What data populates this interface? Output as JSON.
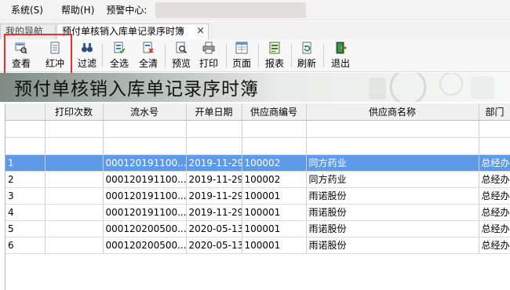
{
  "menubar": {
    "system": "系统(S)",
    "help": "帮助(H)",
    "alert_label": "预警中心:"
  },
  "tabs": {
    "nav": "我的导航",
    "active": "预付单核销入库单记录序时簿",
    "close": "×"
  },
  "toolbar": {
    "view": "查看",
    "redflush": "红冲",
    "filter": "过滤",
    "select_all": "全选",
    "clear_all": "全清",
    "preview": "预览",
    "print": "打印",
    "page": "页面",
    "report": "报表",
    "refresh": "刷新",
    "exit": "退出"
  },
  "banner": {
    "title": "预付单核销入库单记录序时簿"
  },
  "grid": {
    "columns": [
      "打印次数",
      "流水号",
      "开单日期",
      "供应商编号",
      "供应商名称",
      "部门"
    ],
    "rows": [
      {
        "idx": "1",
        "print": "",
        "serial": "000120191100...",
        "date": "2019-11-29",
        "code": "100002",
        "name": "同方药业",
        "dept": "总经办"
      },
      {
        "idx": "2",
        "print": "",
        "serial": "000120191100...",
        "date": "2019-11-29",
        "code": "100002",
        "name": "同方药业",
        "dept": "总经办"
      },
      {
        "idx": "3",
        "print": "",
        "serial": "000120191100...",
        "date": "2019-11-29",
        "code": "100001",
        "name": "雨诺股份",
        "dept": "总经办"
      },
      {
        "idx": "4",
        "print": "",
        "serial": "000120191100...",
        "date": "2019-11-29",
        "code": "100001",
        "name": "雨诺股份",
        "dept": "总经办"
      },
      {
        "idx": "5",
        "print": "",
        "serial": "000120200500...",
        "date": "2020-05-13",
        "code": "100001",
        "name": "雨诺股份",
        "dept": "总经办"
      },
      {
        "idx": "6",
        "print": "",
        "serial": "000120200500...",
        "date": "2020-05-13",
        "code": "100001",
        "name": "雨诺股份",
        "dept": "总经办"
      }
    ]
  }
}
